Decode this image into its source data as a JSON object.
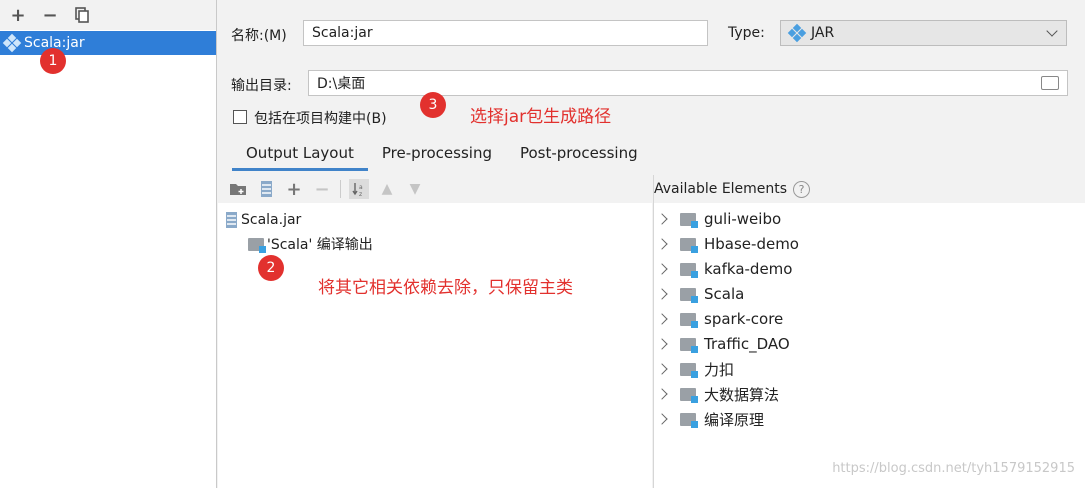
{
  "left_panel": {
    "toolbar": {
      "add": "+",
      "remove": "−"
    },
    "artifact_name": "Scala:jar"
  },
  "form": {
    "name_label": "名称:(M)",
    "name_value": "Scala:jar",
    "type_label": "Type:",
    "type_value": "JAR",
    "output_dir_label": "输出目录:",
    "output_dir_value": "D:\\桌面",
    "include_label": "包括在项目构建中(B)"
  },
  "tabs": [
    "Output Layout",
    "Pre-processing",
    "Post-processing"
  ],
  "layout_tree": {
    "root": "Scala.jar",
    "child": "'Scala' 编译输出"
  },
  "available": {
    "title": "Available Elements",
    "help": "?",
    "items": [
      "guli-weibo",
      "Hbase-demo",
      "kafka-demo",
      "Scala",
      "spark-core",
      "Traffic_DAO",
      "力扣",
      "大数据算法",
      "编译原理"
    ]
  },
  "annotations": {
    "b1": "1",
    "b2": "2",
    "b3": "3",
    "note3": "选择jar包生成路径",
    "note2": "将其它相关依赖去除，只保留主类"
  },
  "watermark": "https://blog.csdn.net/tyh1579152915"
}
